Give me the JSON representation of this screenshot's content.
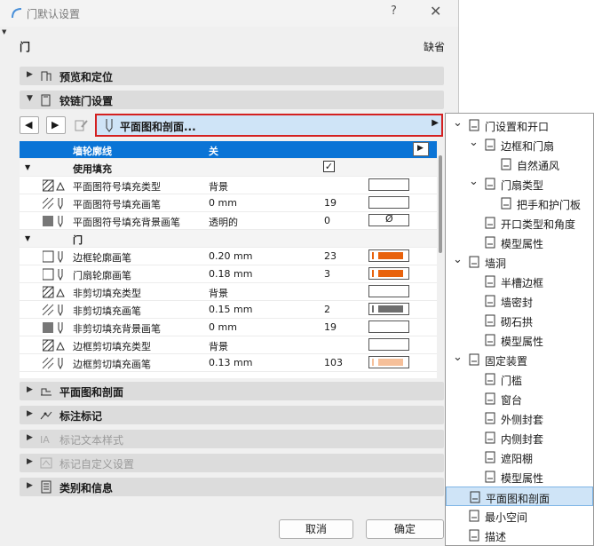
{
  "window": {
    "title": "门默认设置",
    "help": "?",
    "close": "✕"
  },
  "header": {
    "element": "门",
    "default_label": "缺省"
  },
  "panels": {
    "preview": "预览和定位",
    "hinged": "铰链门设置",
    "plan_section": "平面图和剖面",
    "marker": "标注标记",
    "marker_text": "标记文本样式",
    "marker_custom": "标记自定义设置",
    "category": "类别和信息"
  },
  "selector": {
    "label": "平面图和剖面..."
  },
  "table": {
    "header": {
      "name": "墙轮廓线",
      "value": "关"
    },
    "rows": [
      {
        "type": "group",
        "name": "使用填充",
        "checked": true
      },
      {
        "name": "平面图符号填充类型",
        "value": "背景",
        "num": "",
        "swatch": "blank"
      },
      {
        "name": "平面图符号填充画笔",
        "value": "0 mm",
        "num": "19",
        "swatch": "blank"
      },
      {
        "name": "平面图符号填充背景画笔",
        "value": "透明的",
        "num": "0",
        "swatch": "empty"
      },
      {
        "type": "group",
        "name": "门"
      },
      {
        "name": "边框轮廓画笔",
        "value": "0.20 mm",
        "num": "23",
        "swatch": "orange"
      },
      {
        "name": "门扇轮廓画笔",
        "value": "0.18 mm",
        "num": "3",
        "swatch": "orange"
      },
      {
        "name": "非剪切填充类型",
        "value": "背景",
        "num": "",
        "swatch": "blank"
      },
      {
        "name": "非剪切填充画笔",
        "value": "0.15 mm",
        "num": "2",
        "swatch": "gray"
      },
      {
        "name": "非剪切填充背景画笔",
        "value": "0 mm",
        "num": "19",
        "swatch": "blank"
      },
      {
        "name": "边框剪切填充类型",
        "value": "背景",
        "num": "",
        "swatch": "blank"
      },
      {
        "name": "边框剪切填充画笔",
        "value": "0.13 mm",
        "num": "103",
        "swatch": "peach"
      }
    ],
    "empty_symbol": "Ø"
  },
  "buttons": {
    "cancel": "取消",
    "ok": "确定"
  },
  "tree": [
    {
      "label": "门设置和开口",
      "level": 0,
      "chev": "⌄"
    },
    {
      "label": "边框和门扇",
      "level": 1,
      "chev": "⌄"
    },
    {
      "label": "自然通风",
      "level": 2
    },
    {
      "label": "门扇类型",
      "level": 1,
      "chev": "⌄"
    },
    {
      "label": "把手和护门板",
      "level": 2
    },
    {
      "label": "开口类型和角度",
      "level": 1
    },
    {
      "label": "模型属性",
      "level": 1
    },
    {
      "label": "墙洞",
      "level": 0,
      "chev": "⌄"
    },
    {
      "label": "半槽边框",
      "level": 1
    },
    {
      "label": "墙密封",
      "level": 1
    },
    {
      "label": "砌石拱",
      "level": 1
    },
    {
      "label": "模型属性",
      "level": 1
    },
    {
      "label": "固定装置",
      "level": 0,
      "chev": "⌄"
    },
    {
      "label": "门槛",
      "level": 1
    },
    {
      "label": "窗台",
      "level": 1
    },
    {
      "label": "外侧封套",
      "level": 1
    },
    {
      "label": "内侧封套",
      "level": 1
    },
    {
      "label": "遮阳棚",
      "level": 1
    },
    {
      "label": "模型属性",
      "level": 1
    },
    {
      "label": "平面图和剖面",
      "level": 0,
      "selected": true
    },
    {
      "label": "最小空间",
      "level": 0
    },
    {
      "label": "描述",
      "level": 0
    }
  ],
  "colors": {
    "accent": "#0a74d6",
    "highlight": "#cfe4f7",
    "alert_border": "#d42020",
    "orange_pen": "#e8620c",
    "gray_pen": "#6e6e6e",
    "peach_pen": "#f6c09a"
  }
}
